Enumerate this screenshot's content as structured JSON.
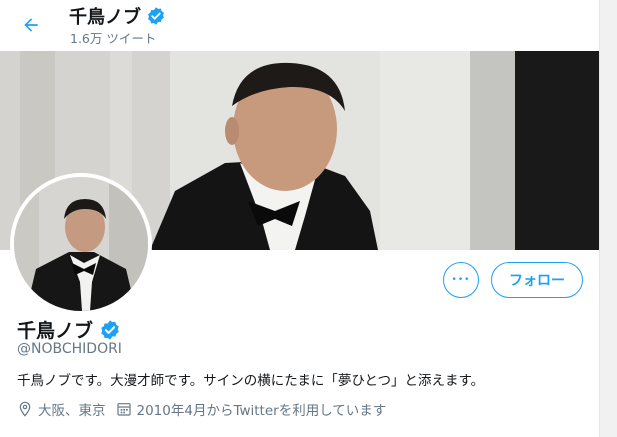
{
  "header": {
    "name": "千鳥ノブ",
    "tweet_count": "1.6万 ツイート"
  },
  "profile": {
    "name": "千鳥ノブ",
    "handle": "@NOBCHIDORI",
    "bio": "千鳥ノブです。大漫才師です。サインの横にたまに「夢ひとつ」と添えます。",
    "location": "大阪、東京",
    "joined": "2010年4月からTwitterを利用しています"
  },
  "actions": {
    "more_label": "•••",
    "follow_label": "フォロー"
  },
  "icons": {
    "back": "arrow-left-icon",
    "verified": "verified-badge-icon",
    "location": "location-pin-icon",
    "calendar": "calendar-icon",
    "more": "more-horizontal-icon"
  },
  "colors": {
    "accent": "#1da1f2",
    "text": "#14171a",
    "secondary": "#657786"
  }
}
